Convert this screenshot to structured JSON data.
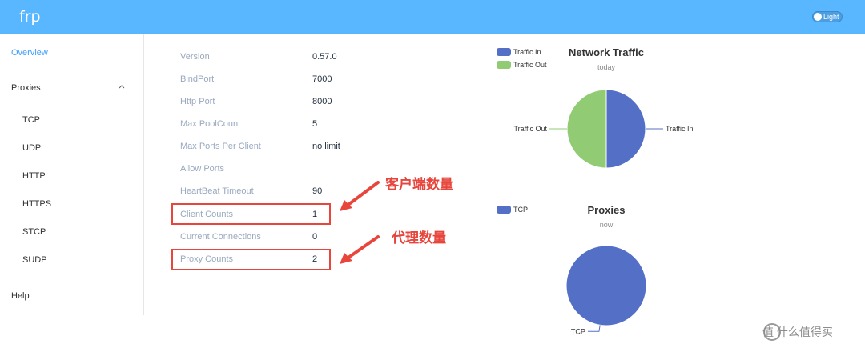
{
  "app": {
    "brand": "frp",
    "theme_label": "Light"
  },
  "sidebar": {
    "overview": "Overview",
    "proxies": "Proxies",
    "proxy_types": [
      "TCP",
      "UDP",
      "HTTP",
      "HTTPS",
      "STCP",
      "SUDP"
    ],
    "help": "Help"
  },
  "server_info": [
    {
      "label": "Version",
      "value": "0.57.0"
    },
    {
      "label": "BindPort",
      "value": "7000"
    },
    {
      "label": "Http Port",
      "value": "8000"
    },
    {
      "label": "Max PoolCount",
      "value": "5"
    },
    {
      "label": "Max Ports Per Client",
      "value": "no limit"
    },
    {
      "label": "Allow Ports",
      "value": ""
    },
    {
      "label": "HeartBeat Timeout",
      "value": "90"
    },
    {
      "label": "Client Counts",
      "value": "1"
    },
    {
      "label": "Current Connections",
      "value": "0"
    },
    {
      "label": "Proxy Counts",
      "value": "2"
    }
  ],
  "annotations": {
    "client_counts": "客户端数量",
    "proxy_counts": "代理数量",
    "color": "#e8453c"
  },
  "colors": {
    "accent": "#58b7ff",
    "active": "#409eff",
    "traffic_in": "#5470c6",
    "traffic_out": "#91cc75",
    "tcp": "#5470c6"
  },
  "chart_data": [
    {
      "type": "pie",
      "title": "Network Traffic",
      "subtitle": "today",
      "legend": [
        "Traffic In",
        "Traffic Out"
      ],
      "legend_position": "top-left",
      "series": [
        {
          "name": "Traffic In",
          "value": 50
        },
        {
          "name": "Traffic Out",
          "value": 50
        }
      ]
    },
    {
      "type": "pie",
      "title": "Proxies",
      "subtitle": "now",
      "legend": [
        "TCP"
      ],
      "legend_position": "top-left",
      "series": [
        {
          "name": "TCP",
          "value": 100
        }
      ]
    }
  ],
  "watermark": "值 什么值得买"
}
